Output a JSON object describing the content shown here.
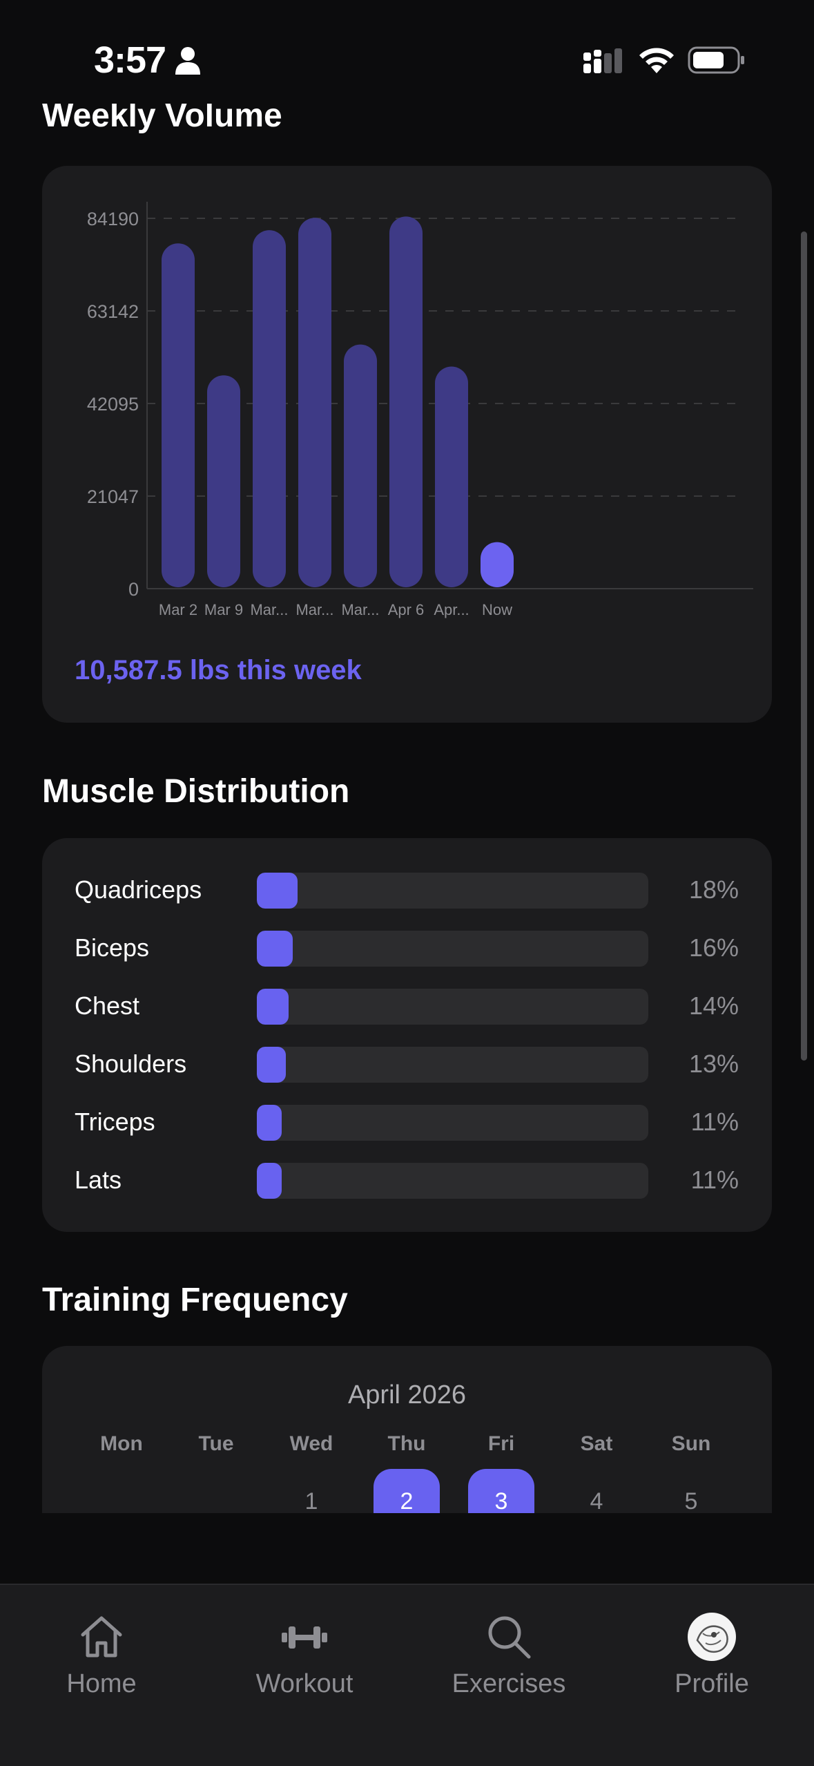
{
  "status_bar": {
    "time": "3:57"
  },
  "weekly_volume": {
    "title": "Weekly Volume",
    "total_text": "10,587.5 lbs this week"
  },
  "chart_data": {
    "type": "bar",
    "categories": [
      "Mar 2",
      "Mar 9",
      "Mar...",
      "Mar...",
      "Mar...",
      "Apr 6",
      "Apr...",
      "Now"
    ],
    "values": [
      78500,
      48500,
      81500,
      84300,
      55500,
      84600,
      50500,
      10587.5
    ],
    "y_ticks": [
      "0",
      "21047",
      "42095",
      "63142",
      "84190"
    ],
    "ylim": [
      0,
      84190
    ],
    "grid": true,
    "colors": {
      "past_weeks": "#3e3a86",
      "current_week": "#6c63f0"
    }
  },
  "muscle_distribution": {
    "title": "Muscle Distribution",
    "items": [
      {
        "name": "Quadriceps",
        "percent_label": "18%",
        "value": 18
      },
      {
        "name": "Biceps",
        "percent_label": "16%",
        "value": 16
      },
      {
        "name": "Chest",
        "percent_label": "14%",
        "value": 14
      },
      {
        "name": "Shoulders",
        "percent_label": "13%",
        "value": 13
      },
      {
        "name": "Triceps",
        "percent_label": "11%",
        "value": 11
      },
      {
        "name": "Lats",
        "percent_label": "11%",
        "value": 11
      }
    ]
  },
  "training_frequency": {
    "title": "Training Frequency",
    "month": "April 2026",
    "weekdays": [
      "Mon",
      "Tue",
      "Wed",
      "Thu",
      "Fri",
      "Sat",
      "Sun"
    ],
    "days": [
      {
        "label": "1",
        "active": false
      },
      {
        "label": "2",
        "active": true
      },
      {
        "label": "3",
        "active": true
      },
      {
        "label": "4",
        "active": false
      },
      {
        "label": "5",
        "active": false
      }
    ]
  },
  "tab_bar": {
    "tabs": [
      {
        "label": "Home",
        "icon": "home-icon"
      },
      {
        "label": "Workout",
        "icon": "dumbbell-icon"
      },
      {
        "label": "Exercises",
        "icon": "search-icon"
      },
      {
        "label": "Profile",
        "icon": "avatar"
      }
    ]
  }
}
